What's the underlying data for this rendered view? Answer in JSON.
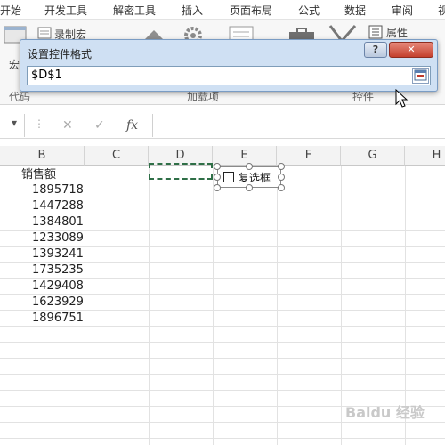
{
  "menu": [
    "开始",
    "开发工具",
    "解密工具",
    "插入",
    "页面布局",
    "公式",
    "数据",
    "审阅",
    "视"
  ],
  "ribbon": {
    "record_macro": "录制宏",
    "macro": "宏",
    "properties": "属性",
    "groups": [
      "代码",
      "加载项",
      "控件"
    ]
  },
  "dialog": {
    "title": "设置控件格式",
    "help": "?",
    "close": "✕",
    "reference": "$D$1"
  },
  "formula_bar": {
    "cancel_symbol": "✕",
    "enter_symbol": "✓",
    "fx_symbol": "fx",
    "separator_symbol": "⋮",
    "dropdown_symbol": "▾"
  },
  "columns": [
    "B",
    "C",
    "D",
    "E",
    "F",
    "G",
    "H"
  ],
  "sales": {
    "header": "销售额",
    "values": [
      "1895718",
      "1447288",
      "1384801",
      "1233089",
      "1393241",
      "1735235",
      "1429408",
      "1623929",
      "1896751"
    ]
  },
  "checkbox": {
    "label": "复选框",
    "checked": false
  },
  "watermark": "Baidu 经验",
  "colors": {
    "dialog_bg": "#cfe0f3",
    "close_red": "#c4402d",
    "marquee": "#2f6f47"
  }
}
